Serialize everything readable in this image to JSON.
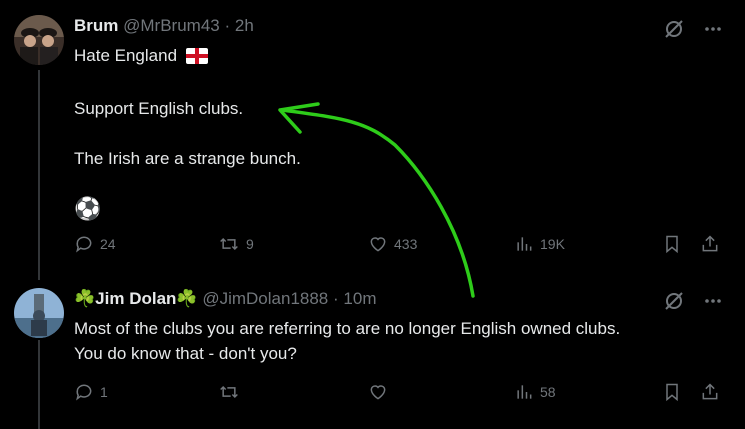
{
  "tweet1": {
    "name": "Brum",
    "handle": "@MrBrum43",
    "separator": "·",
    "time": "2h",
    "line1": "Hate England",
    "line2": "Support English clubs.",
    "line3": "The Irish are a strange bunch.",
    "flag_emoji": "england-flag",
    "ball_emoji": "⚽",
    "replies": "24",
    "retweets": "9",
    "likes": "433",
    "views": "19K"
  },
  "tweet2": {
    "name_prefix": "☘️",
    "name": "Jim Dolan",
    "name_suffix": "☘️",
    "handle": "@JimDolan1888",
    "separator": "·",
    "time": "10m",
    "line1": "Most of the clubs you are referring to are no longer English owned clubs.",
    "line2": "You do know that - don't you?",
    "replies": "1",
    "retweets": "",
    "likes": "",
    "views": "58"
  },
  "colors": {
    "background": "#000000",
    "text": "#e7e9ea",
    "secondary": "#71767b",
    "annotation_arrow": "#2ecc1a"
  }
}
